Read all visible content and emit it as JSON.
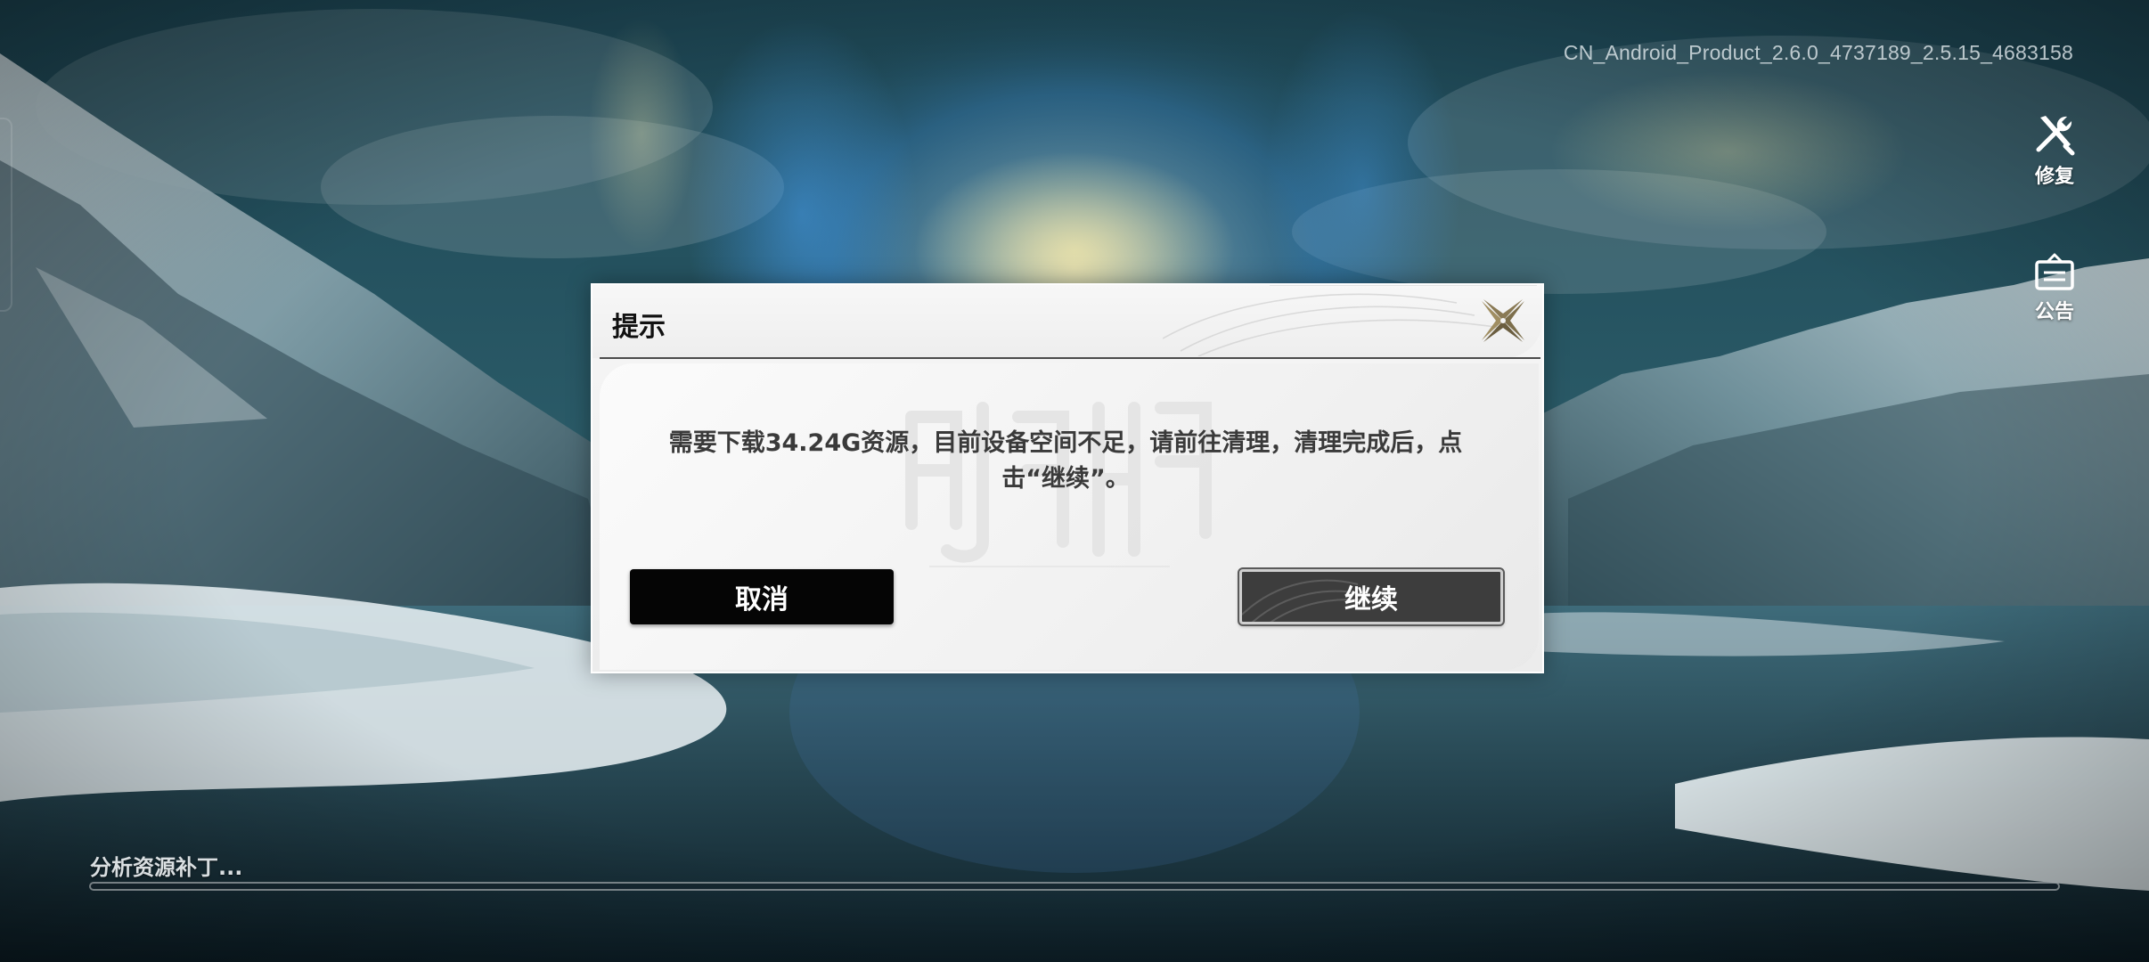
{
  "version": "CN_Android_Product_2.6.0_4737189_2.5.15_4683158",
  "side_buttons": {
    "repair": {
      "label": "修复",
      "icon": "wrench-screwdriver-icon"
    },
    "notice": {
      "label": "公告",
      "icon": "notice-board-icon"
    }
  },
  "dialog": {
    "title": "提示",
    "message": "需要下载34.24G资源，目前设备空间不足，请前往清理，清理完成后，点击“继续”。",
    "cancel_label": "取消",
    "continue_label": "继续",
    "close_icon": "close-star-icon"
  },
  "loading": {
    "status": "分析资源补丁...",
    "progress": 0
  },
  "colors": {
    "dialog_bg": "#f3f3f3",
    "primary_button": "#050505",
    "secondary_button": "#3d3d3d",
    "accent_gold": "#8a7a55"
  }
}
